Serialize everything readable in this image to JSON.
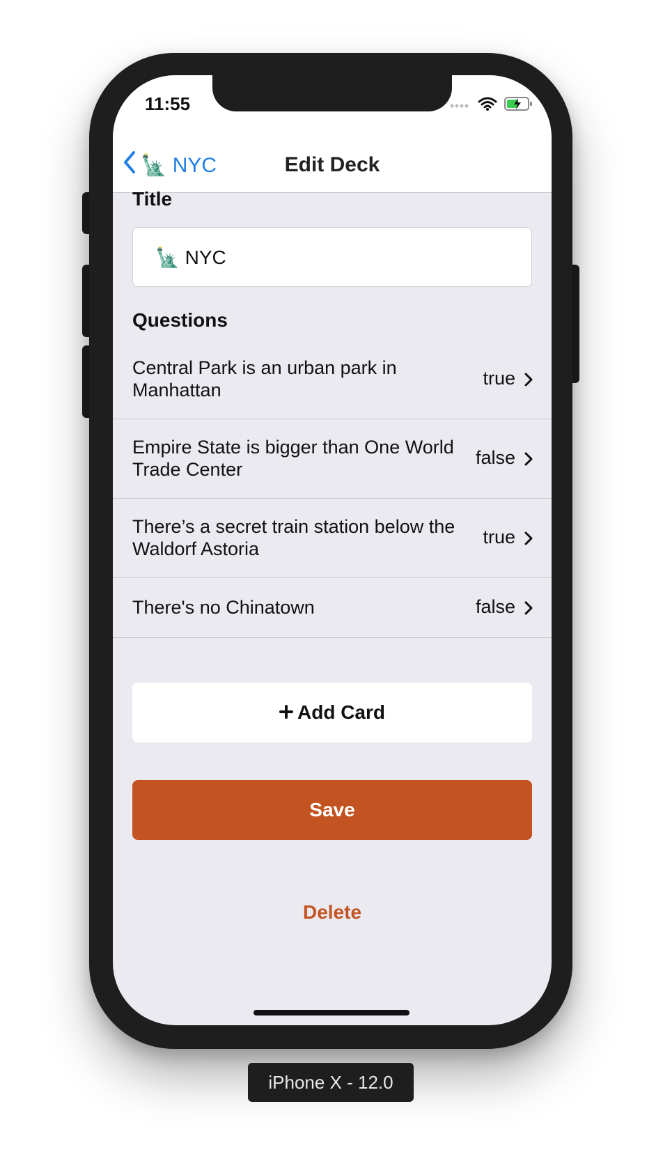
{
  "status_bar": {
    "time": "11:55"
  },
  "nav": {
    "back_label": "🗽 NYC",
    "title": "Edit Deck"
  },
  "form": {
    "title_label": "Title",
    "title_value": "🗽 NYC",
    "questions_label": "Questions"
  },
  "questions": [
    {
      "text": "Central Park is an urban park in Manhattan",
      "answer": "true"
    },
    {
      "text": "Empire State is bigger than One World Trade Center",
      "answer": "false"
    },
    {
      "text": "There’s a secret train station below the Waldorf Astoria",
      "answer": "true"
    },
    {
      "text": "There's no Chinatown",
      "answer": "false"
    }
  ],
  "actions": {
    "add_card_label": "Add Card",
    "save_label": "Save",
    "delete_label": "Delete"
  },
  "device_label": "iPhone X - 12.0",
  "colors": {
    "accent": "#c35422",
    "link": "#1f7fe6",
    "background": "#ebeaf0"
  }
}
